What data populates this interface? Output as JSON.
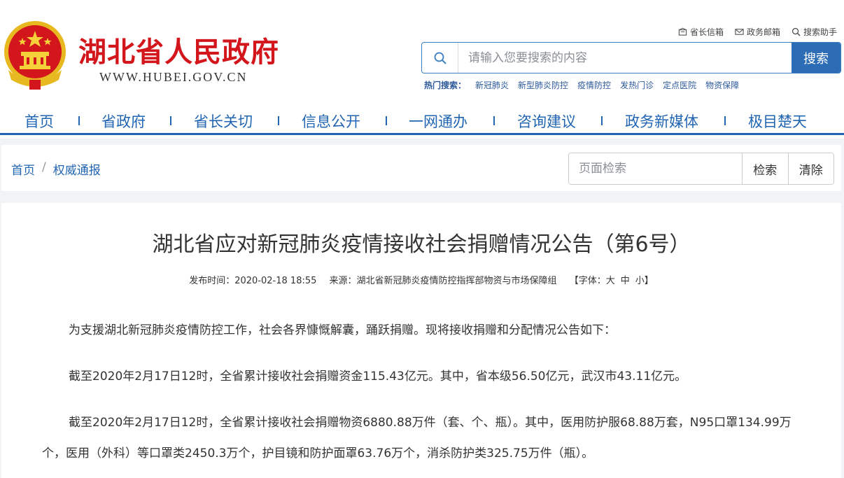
{
  "header": {
    "title": "湖北省人民政府",
    "url": "WWW.HUBEI.GOV.CN",
    "top_links": [
      {
        "label": "省长信箱",
        "icon": "mailbox-icon"
      },
      {
        "label": "政务邮箱",
        "icon": "envelope-icon"
      },
      {
        "label": "搜索助手",
        "icon": "search-icon"
      }
    ],
    "search": {
      "placeholder": "请输入您要搜索的内容",
      "button": "搜索"
    },
    "hot_search": {
      "label": "热门搜索：",
      "items": [
        "新冠肺炎",
        "新型肺炎防控",
        "疫情防控",
        "发热门诊",
        "定点医院",
        "物资保障"
      ]
    }
  },
  "nav": [
    "首页",
    "省政府",
    "省长关切",
    "信息公开",
    "一网通办",
    "咨询建议",
    "政务新媒体",
    "极目楚天"
  ],
  "breadcrumb": {
    "home": "首页",
    "sep": "/",
    "current": "权威通报"
  },
  "page_search": {
    "placeholder": "页面检索",
    "search": "检索",
    "clear": "清除"
  },
  "article": {
    "title": "湖北省应对新冠肺炎疫情接收社会捐赠情况公告（第6号）",
    "meta": {
      "time": "发布时间：2020-02-18 18:55",
      "source": "来源：湖北省新冠肺炎疫情防控指挥部物资与市场保障组",
      "font_label": "【字体：",
      "font_large": "大",
      "font_mid": "中",
      "font_small": "小",
      "font_end": "】"
    },
    "paragraphs": [
      "为支援湖北新冠肺炎疫情防控工作，社会各界慷慨解囊，踊跃捐赠。现将接收捐赠和分配情况公告如下：",
      "截至2020年2月17日12时，全省累计接收社会捐赠资金115.43亿元。其中，省本级56.50亿元，武汉市43.11亿元。",
      "截至2020年2月17日12时，全省累计接收社会捐赠物资6880.88万件（套、个、瓶）。其中，医用防护服68.88万套，N95口罩134.99万个，医用（外科）等口罩类2450.3万个，护目镜和防护面罩63.76万个，消杀防护类325.75万件（瓶）。"
    ]
  },
  "colors": {
    "brand_red": "#d3161c",
    "nav_blue": "#2266b2",
    "search_blue": "#2d6db5"
  }
}
